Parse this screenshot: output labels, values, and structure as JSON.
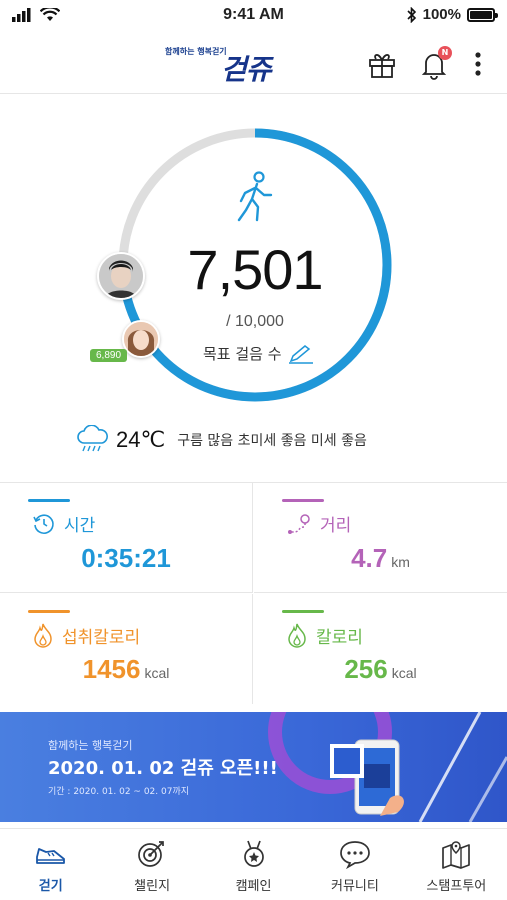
{
  "status_bar": {
    "time": "9:41 AM",
    "battery": "100%",
    "battery_level": 1.0
  },
  "header": {
    "logo_tagline": "함께하는 행복걷기",
    "logo_text": "걷쥬",
    "notification_badge": "N"
  },
  "activity": {
    "steps": "7,501",
    "goal": "/ 10,000",
    "goal_label": "목표 걸음 수",
    "progress": 0.75,
    "friend_steps": "6,890"
  },
  "weather": {
    "temperature": "24℃",
    "description": "구름 많음  초미세 좋음  미세 좋음"
  },
  "stats": [
    {
      "label": "시간",
      "value": "0:35:21",
      "unit": "",
      "color": "#1f97d8",
      "icon": "clock-icon"
    },
    {
      "label": "거리",
      "value": "4.7",
      "unit": "km",
      "color": "#b463b8",
      "icon": "route-icon"
    },
    {
      "label": "섭취칼로리",
      "value": "1456",
      "unit": "kcal",
      "color": "#f0932b",
      "icon": "flame-icon"
    },
    {
      "label": "칼로리",
      "value": "256",
      "unit": "kcal",
      "color": "#67b84a",
      "icon": "flame-icon"
    }
  ],
  "banner": {
    "subtitle": "함께하는 행복걷기",
    "title": "2020. 01. 02 걷쥬 오픈!!!",
    "period": "기간 : 2020. 01. 02 ~ 02. 07까지"
  },
  "nav": [
    {
      "label": "걷기",
      "icon": "shoe-icon",
      "active": true
    },
    {
      "label": "챌린지",
      "icon": "target-icon",
      "active": false
    },
    {
      "label": "캠페인",
      "icon": "medal-icon",
      "active": false
    },
    {
      "label": "커뮤니티",
      "icon": "chat-icon",
      "active": false
    },
    {
      "label": "스탬프투어",
      "icon": "map-icon",
      "active": false
    }
  ],
  "colors": {
    "ring_progress": "#1f97d8",
    "ring_track": "#dedede",
    "brand": "#16348a"
  }
}
